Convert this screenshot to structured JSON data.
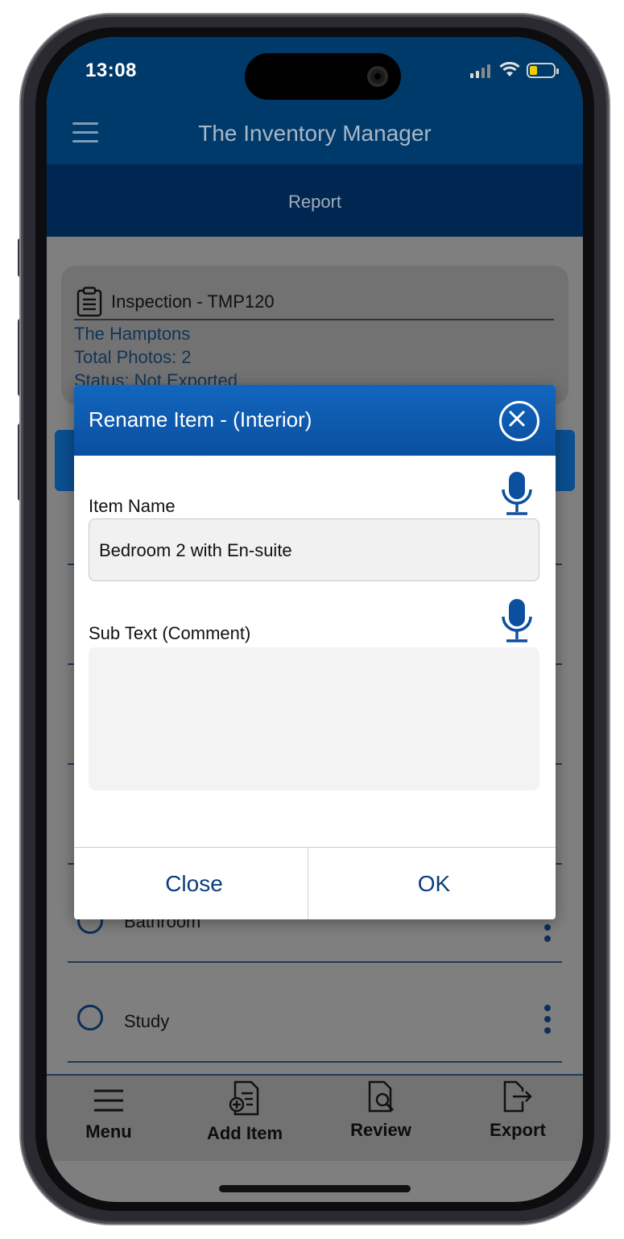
{
  "status_bar": {
    "time": "13:08"
  },
  "header": {
    "title": "The Inventory Manager",
    "subtitle": "Report"
  },
  "inspection_card": {
    "title": "Inspection - TMP120",
    "property": "The Hamptons",
    "total_photos": "Total Photos: 2",
    "status": "Status: Not Exported"
  },
  "list": {
    "items": [
      {
        "label": "Bathroom"
      },
      {
        "label": "Study"
      }
    ]
  },
  "bottom_nav": {
    "items": [
      {
        "label": "Menu",
        "icon": "menu-icon"
      },
      {
        "label": "Add Item",
        "icon": "add-item-icon"
      },
      {
        "label": "Review",
        "icon": "review-icon"
      },
      {
        "label": "Export",
        "icon": "export-icon"
      }
    ]
  },
  "modal": {
    "title": "Rename Item - (Interior)",
    "item_name_label": "Item Name",
    "item_name_value": "Bedroom 2 with En-suite",
    "sub_text_label": "Sub Text (Comment)",
    "sub_text_value": "",
    "close_label": "Close",
    "ok_label": "OK"
  },
  "colors": {
    "header_blue": "#003a6b",
    "subheader_blue": "#002752",
    "modal_header_blue": "#0a4f9f",
    "button_text_blue": "#0a3d7d",
    "overlay_gray": "#7f7f7f"
  }
}
